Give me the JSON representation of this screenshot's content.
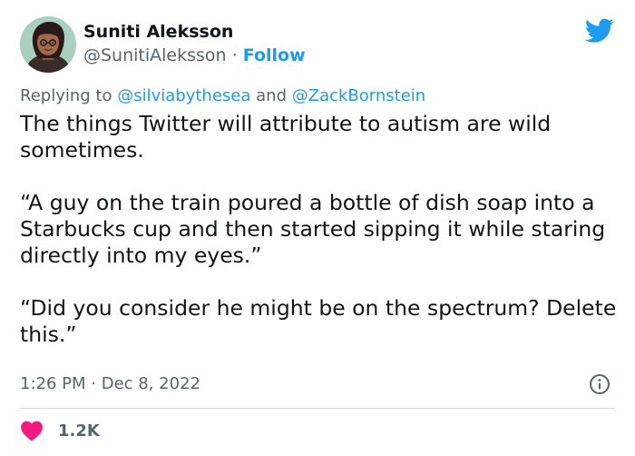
{
  "author": {
    "name": "Suniti Aleksson",
    "handle": "@SunitiAleksson",
    "separator": "·",
    "follow_label": "Follow"
  },
  "reply": {
    "prefix": "Replying to",
    "mention_1": "@silviabythesea",
    "joiner": "and",
    "mention_2": "@ZackBornstein"
  },
  "body": {
    "paragraphs": [
      "The things Twitter will attribute to autism are wild sometimes.",
      "“A guy on the train poured a bottle of dish soap into a Starbucks cup and then started sipping it while staring directly into my eyes.”",
      "“Did you consider he might be on the spectrum? Delete this.”"
    ]
  },
  "meta": {
    "time": "1:26 PM",
    "separator": "·",
    "date": "Dec 8, 2022"
  },
  "actions": {
    "like_count": "1.2K"
  },
  "icons": {
    "brand": "twitter-bird-icon",
    "info": "info-icon",
    "like": "heart-icon"
  },
  "colors": {
    "accent": "#1d9bf0",
    "like": "#f91880",
    "secondary_text": "#536471",
    "primary_text": "#0f1419",
    "divider": "#cfd9de"
  }
}
